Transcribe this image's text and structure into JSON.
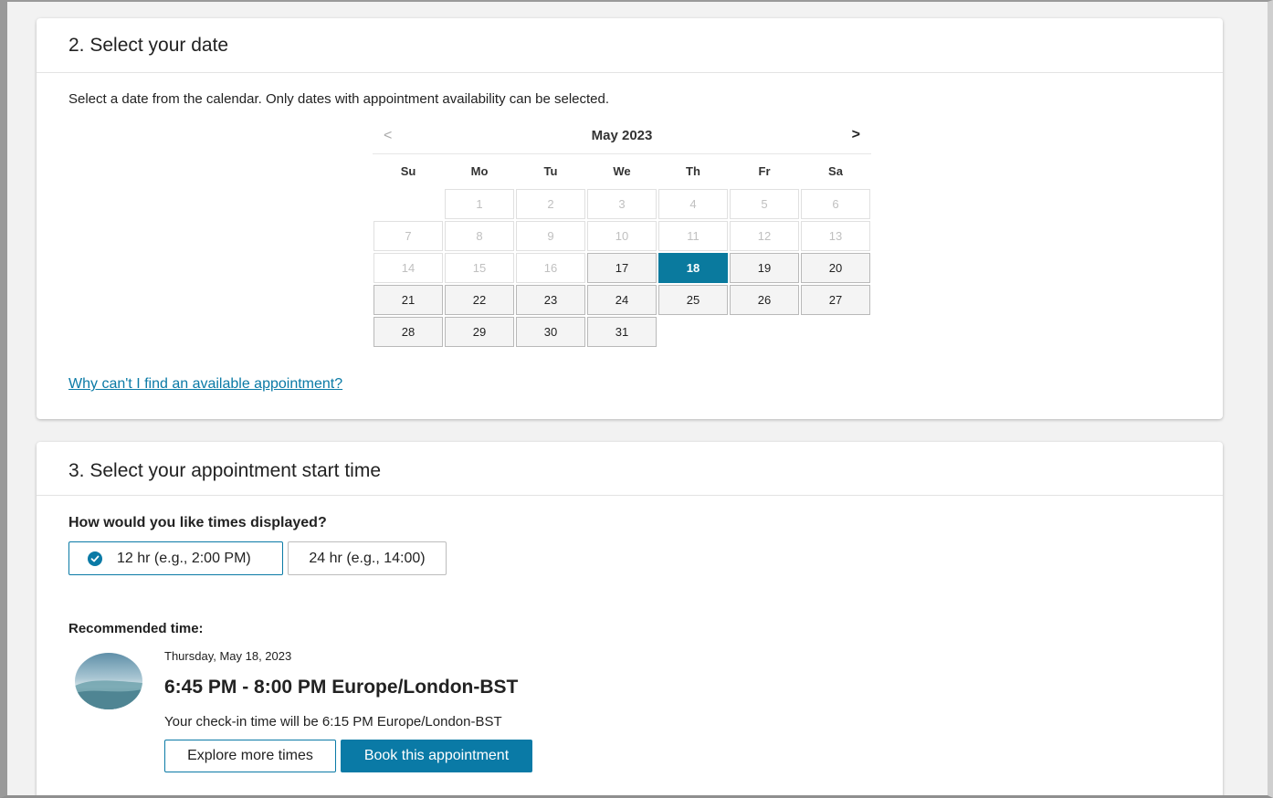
{
  "date_section": {
    "header": "2. Select your date",
    "instruction": "Select a date from the calendar. Only dates with appointment availability can be selected.",
    "help_link": "Why can't I find an available appointment?"
  },
  "calendar": {
    "month_title": "May 2023",
    "prev_label": "<",
    "next_label": ">",
    "weekdays": [
      "Su",
      "Mo",
      "Tu",
      "We",
      "Th",
      "Fr",
      "Sa"
    ],
    "leading_blanks": 1,
    "days": [
      {
        "n": "1",
        "state": "disabled"
      },
      {
        "n": "2",
        "state": "disabled"
      },
      {
        "n": "3",
        "state": "disabled"
      },
      {
        "n": "4",
        "state": "disabled"
      },
      {
        "n": "5",
        "state": "disabled"
      },
      {
        "n": "6",
        "state": "disabled"
      },
      {
        "n": "7",
        "state": "disabled"
      },
      {
        "n": "8",
        "state": "disabled"
      },
      {
        "n": "9",
        "state": "disabled"
      },
      {
        "n": "10",
        "state": "disabled"
      },
      {
        "n": "11",
        "state": "disabled"
      },
      {
        "n": "12",
        "state": "disabled"
      },
      {
        "n": "13",
        "state": "disabled"
      },
      {
        "n": "14",
        "state": "disabled"
      },
      {
        "n": "15",
        "state": "disabled"
      },
      {
        "n": "16",
        "state": "disabled"
      },
      {
        "n": "17",
        "state": "available"
      },
      {
        "n": "18",
        "state": "selected"
      },
      {
        "n": "19",
        "state": "available"
      },
      {
        "n": "20",
        "state": "available"
      },
      {
        "n": "21",
        "state": "available"
      },
      {
        "n": "22",
        "state": "available"
      },
      {
        "n": "23",
        "state": "available"
      },
      {
        "n": "24",
        "state": "available"
      },
      {
        "n": "25",
        "state": "available"
      },
      {
        "n": "26",
        "state": "available"
      },
      {
        "n": "27",
        "state": "available"
      },
      {
        "n": "28",
        "state": "available"
      },
      {
        "n": "29",
        "state": "available"
      },
      {
        "n": "30",
        "state": "available"
      },
      {
        "n": "31",
        "state": "available"
      }
    ]
  },
  "time_section": {
    "header": "3. Select your appointment start time",
    "question": "How would you like times displayed?",
    "format_12": "12 hr (e.g., 2:00 PM)",
    "format_24": "24 hr (e.g., 14:00)",
    "selected_format": "12",
    "recommended_label": "Recommended time:",
    "recommended": {
      "date": "Thursday, May 18, 2023",
      "range": "6:45 PM - 8:00 PM Europe/London-BST",
      "checkin": "Your check-in time will be 6:15 PM Europe/London-BST",
      "image_icon": "landscape-image-icon"
    },
    "explore_label": "Explore more times",
    "book_label": "Book this appointment"
  },
  "colors": {
    "accent": "#0a7aa6",
    "selected_day": "#0a7a9e"
  }
}
